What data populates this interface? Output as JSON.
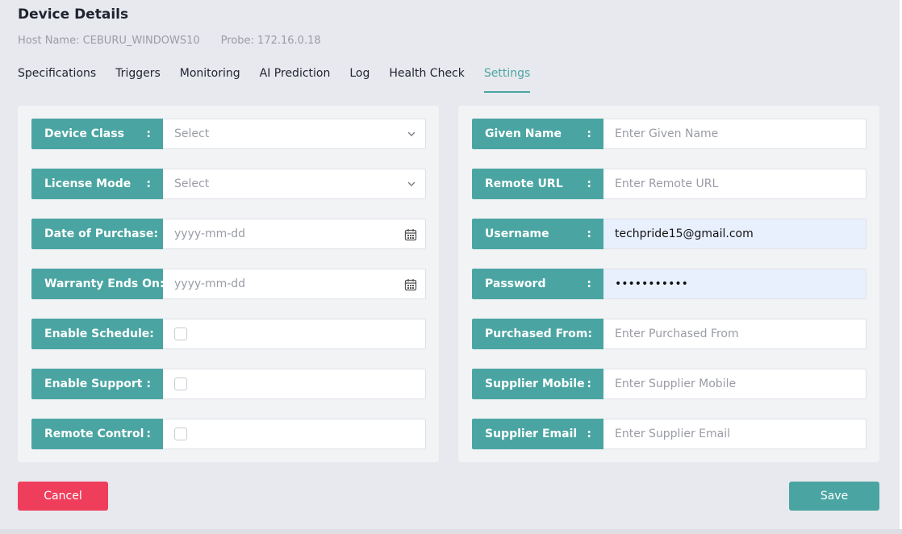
{
  "header": {
    "title": "Device Details",
    "host_name": "Host Name: CEBURU_WINDOWS10",
    "probe": "Probe: 172.16.0.18"
  },
  "tabs": [
    {
      "label": "Specifications",
      "active": false
    },
    {
      "label": "Triggers",
      "active": false
    },
    {
      "label": "Monitoring",
      "active": false
    },
    {
      "label": "AI Prediction",
      "active": false
    },
    {
      "label": "Log",
      "active": false
    },
    {
      "label": "Health Check",
      "active": false
    },
    {
      "label": "Settings",
      "active": true
    }
  ],
  "left_fields": {
    "device_class": {
      "label": "Device Class",
      "colon": ":",
      "placeholder": "Select"
    },
    "license_mode": {
      "label": "License Mode",
      "colon": ":",
      "placeholder": "Select"
    },
    "date_of_purchase": {
      "label": "Date of Purchase",
      "colon": ":",
      "placeholder": "yyyy-mm-dd"
    },
    "warranty_ends_on": {
      "label": "Warranty Ends On",
      "colon": ":",
      "placeholder": "yyyy-mm-dd"
    },
    "enable_schedule": {
      "label": "Enable Schedule",
      "colon": ":",
      "checked": false
    },
    "enable_support": {
      "label": "Enable Support",
      "colon": ":",
      "checked": false
    },
    "remote_control": {
      "label": "Remote Control",
      "colon": ":",
      "checked": false
    }
  },
  "right_fields": {
    "given_name": {
      "label": "Given Name",
      "colon": ":",
      "placeholder": "Enter Given Name"
    },
    "remote_url": {
      "label": "Remote URL",
      "colon": ":",
      "placeholder": "Enter Remote URL"
    },
    "username": {
      "label": "Username",
      "colon": ":",
      "value": "techpride15@gmail.com"
    },
    "password": {
      "label": "Password",
      "colon": ":",
      "value": "•••••••••••"
    },
    "purchased_from": {
      "label": "Purchased From",
      "colon": ":",
      "placeholder": "Enter Purchased From"
    },
    "supplier_mobile": {
      "label": "Supplier Mobile",
      "colon": ":",
      "placeholder": "Enter Supplier Mobile"
    },
    "supplier_email": {
      "label": "Supplier Email",
      "colon": ":",
      "placeholder": "Enter Supplier Email"
    }
  },
  "buttons": {
    "cancel": "Cancel",
    "save": "Save"
  },
  "icons": {
    "select_arrow": "chevron-down-icon",
    "date_picker": "calendar-icon"
  },
  "colors": {
    "accent": "#4aa5a2",
    "danger": "#ef3e5c",
    "autofill": "#e8f0fe"
  }
}
